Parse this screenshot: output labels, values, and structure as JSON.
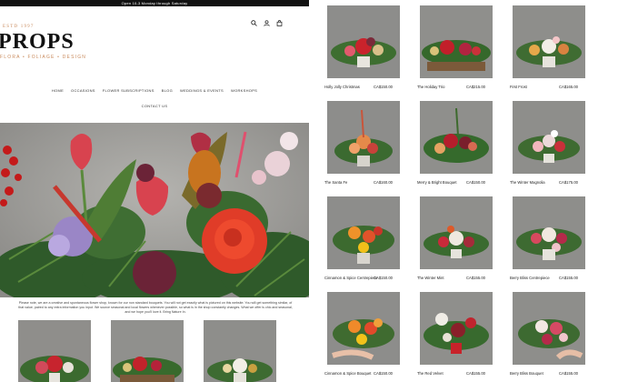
{
  "announcement": "Open 10-3 Monday through Saturday",
  "logo": {
    "est": "ESTD 1997",
    "name": "PROPS",
    "tagline": "FLORA • FOLIAGE • DESIGN"
  },
  "header_icons": [
    "search-icon",
    "account-icon",
    "cart-icon"
  ],
  "nav": {
    "items": [
      "HOME",
      "OCCASIONS",
      "FLOWER SUBSCRIPTIONS",
      "BLOG",
      "WEDDINGS & EVENTS",
      "WORKSHOPS"
    ],
    "second_row": "CONTACT US"
  },
  "blurb": "Please note, we are a creative and spontaneous flower shop, known for our non standard bouquets. You will not get exactly what is pictured on this website. You will get something similar, of that value, paired to any extra information you input. We source seasonal and local flowers whenever possible, so what is in the shop constantly changes. What we offer is chic and seasonal, and we hope you'll love it. Bring Nature In.",
  "products": [
    {
      "name": "Holly Jolly Christmas",
      "price": "CA$150.00"
    },
    {
      "name": "The Holiday Trio",
      "price": "CA$215.00"
    },
    {
      "name": "First Frost",
      "price": "CA$165.00"
    },
    {
      "name": "The Santa Fe",
      "price": "CA$160.00"
    },
    {
      "name": "Merry & Bright Bouquet",
      "price": "CA$150.00"
    },
    {
      "name": "The Winter Magnolia",
      "price": "CA$175.00"
    },
    {
      "name": "Cinnamon & Spice Centrepiece",
      "price": "CA$150.00"
    },
    {
      "name": "The Winter Mint",
      "price": "CA$155.00"
    },
    {
      "name": "Berry Bliss Centrepiece",
      "price": "CA$155.00"
    },
    {
      "name": "Cinnamon & Spice Bouquet",
      "price": "CA$150.00"
    },
    {
      "name": "The Red Velvet",
      "price": "CA$155.00"
    },
    {
      "name": "Berry Bliss Bouquet",
      "price": "CA$155.00"
    }
  ],
  "colors": {
    "accent": "#c98a5c",
    "announcement_bg": "#111111"
  }
}
